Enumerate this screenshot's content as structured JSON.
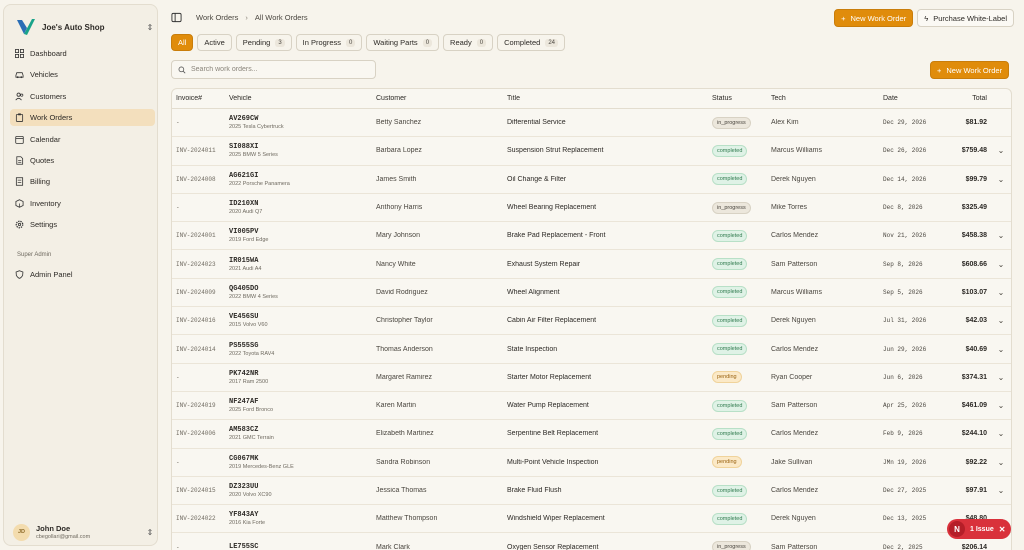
{
  "sidebar": {
    "shop_name": "Joe's Auto Shop",
    "items": [
      {
        "label": "Dashboard",
        "icon": "grid-icon"
      },
      {
        "label": "Vehicles",
        "icon": "car-icon"
      },
      {
        "label": "Customers",
        "icon": "users-icon"
      },
      {
        "label": "Work Orders",
        "icon": "clipboard-icon",
        "active": true
      },
      {
        "label": "Calendar",
        "icon": "calendar-icon"
      },
      {
        "label": "Quotes",
        "icon": "document-icon"
      },
      {
        "label": "Billing",
        "icon": "receipt-icon"
      },
      {
        "label": "Inventory",
        "icon": "box-icon"
      },
      {
        "label": "Settings",
        "icon": "gear-icon"
      }
    ],
    "section_label": "Super Admin",
    "admin_item": {
      "label": "Admin Panel",
      "icon": "shield-icon"
    },
    "user": {
      "initials": "JD",
      "name": "John Doe",
      "email": "cbegollari@gmail.com"
    }
  },
  "header": {
    "breadcrumb": [
      "Work Orders",
      "All Work Orders"
    ],
    "new_work_order": "New Work Order",
    "purchase_white_label": "Purchase White-Label"
  },
  "tabs": [
    {
      "label": "All",
      "count": null,
      "active": true
    },
    {
      "label": "Active",
      "count": null
    },
    {
      "label": "Pending",
      "count": "3"
    },
    {
      "label": "In Progress",
      "count": "0"
    },
    {
      "label": "Waiting Parts",
      "count": "0"
    },
    {
      "label": "Ready",
      "count": "0"
    },
    {
      "label": "Completed",
      "count": "24"
    }
  ],
  "search": {
    "placeholder": "Search work orders..."
  },
  "new_work_order_button": "New Work Order",
  "table": {
    "columns": [
      "Invoice#",
      "Vehicle",
      "Customer",
      "Title",
      "Status",
      "Tech",
      "Date",
      "Total"
    ],
    "rows": [
      {
        "invoice": "-",
        "plate": "AV269CW",
        "model": "2025 Tesla Cybertruck",
        "customer": "Betty Sanchez",
        "title": "Differential Service",
        "status": "in_progress",
        "tech": "Alex Kim",
        "date": "Dec 29, 2026",
        "total": "$81.92",
        "expand": false
      },
      {
        "invoice": "INV-2024011",
        "plate": "SI088XI",
        "model": "2025 BMW 5 Series",
        "customer": "Barbara Lopez",
        "title": "Suspension Strut Replacement",
        "status": "completed",
        "tech": "Marcus Williams",
        "date": "Dec 26, 2026",
        "total": "$759.48",
        "expand": true
      },
      {
        "invoice": "INV-2024008",
        "plate": "AG621GI",
        "model": "2022 Porsche Panamera",
        "customer": "James Smith",
        "title": "Oil Change & Filter",
        "status": "completed",
        "tech": "Derek Nguyen",
        "date": "Dec 14, 2026",
        "total": "$99.79",
        "expand": true
      },
      {
        "invoice": "-",
        "plate": "ID210XN",
        "model": "2020 Audi Q7",
        "customer": "Anthony Harris",
        "title": "Wheel Bearing Replacement",
        "status": "in_progress",
        "tech": "Mike Torres",
        "date": "Dec 8, 2026",
        "total": "$325.49",
        "expand": false
      },
      {
        "invoice": "INV-2024001",
        "plate": "VI005PV",
        "model": "2019 Ford Edge",
        "customer": "Mary Johnson",
        "title": "Brake Pad Replacement - Front",
        "status": "completed",
        "tech": "Carlos Mendez",
        "date": "Nov 21, 2026",
        "total": "$458.38",
        "expand": true
      },
      {
        "invoice": "INV-2024023",
        "plate": "IR015WA",
        "model": "2021 Audi A4",
        "customer": "Nancy White",
        "title": "Exhaust System Repair",
        "status": "completed",
        "tech": "Sam Patterson",
        "date": "Sep 8, 2026",
        "total": "$608.66",
        "expand": true
      },
      {
        "invoice": "INV-2024009",
        "plate": "QG405DO",
        "model": "2022 BMW 4 Series",
        "customer": "David Rodriguez",
        "title": "Wheel Alignment",
        "status": "completed",
        "tech": "Marcus Williams",
        "date": "Sep 5, 2026",
        "total": "$103.07",
        "expand": true
      },
      {
        "invoice": "INV-2024016",
        "plate": "VE456SU",
        "model": "2015 Volvo V60",
        "customer": "Christopher Taylor",
        "title": "Cabin Air Filter Replacement",
        "status": "completed",
        "tech": "Derek Nguyen",
        "date": "Jul 31, 2026",
        "total": "$42.03",
        "expand": true
      },
      {
        "invoice": "INV-2024014",
        "plate": "PS555SG",
        "model": "2022 Toyota RAV4",
        "customer": "Thomas Anderson",
        "title": "State Inspection",
        "status": "completed",
        "tech": "Carlos Mendez",
        "date": "Jun 29, 2026",
        "total": "$40.69",
        "expand": true
      },
      {
        "invoice": "-",
        "plate": "PK742NR",
        "model": "2017 Ram 2500",
        "customer": "Margaret Ramirez",
        "title": "Starter Motor Replacement",
        "status": "pending",
        "tech": "Ryan Cooper",
        "date": "Jun 6, 2026",
        "total": "$374.31",
        "expand": true
      },
      {
        "invoice": "INV-2024019",
        "plate": "NF247AF",
        "model": "2025 Ford Bronco",
        "customer": "Karen Martin",
        "title": "Water Pump Replacement",
        "status": "completed",
        "tech": "Sam Patterson",
        "date": "Apr 25, 2026",
        "total": "$461.09",
        "expand": true
      },
      {
        "invoice": "INV-2024006",
        "plate": "AM583CZ",
        "model": "2021 GMC Terrain",
        "customer": "Elizabeth Martinez",
        "title": "Serpentine Belt Replacement",
        "status": "completed",
        "tech": "Carlos Mendez",
        "date": "Feb 9, 2026",
        "total": "$244.10",
        "expand": true
      },
      {
        "invoice": "-",
        "plate": "CG067MK",
        "model": "2019 Mercedes-Benz GLE",
        "customer": "Sandra Robinson",
        "title": "Multi-Point Vehicle Inspection",
        "status": "pending",
        "tech": "Jake Sullivan",
        "date": "JMn 19, 2026",
        "total": "$92.22",
        "expand": true
      },
      {
        "invoice": "INV-2024015",
        "plate": "DZ323UU",
        "model": "2020 Volvo XC90",
        "customer": "Jessica Thomas",
        "title": "Brake Fluid Flush",
        "status": "completed",
        "tech": "Carlos Mendez",
        "date": "Dec 27, 2025",
        "total": "$97.91",
        "expand": true
      },
      {
        "invoice": "INV-2024022",
        "plate": "YF843AY",
        "model": "2016 Kia Forte",
        "customer": "Matthew Thompson",
        "title": "Windshield Wiper Replacement",
        "status": "completed",
        "tech": "Derek Nguyen",
        "date": "Dec 13, 2025",
        "total": "$48.80",
        "expand": true
      },
      {
        "invoice": "-",
        "plate": "LE755SC",
        "model": "",
        "customer": "Mark Clark",
        "title": "Oxygen Sensor Replacement",
        "status": "in_progress",
        "tech": "Sam Patterson",
        "date": "Dec 2, 2025",
        "total": "$206.14",
        "expand": false
      }
    ]
  },
  "issue_badge": {
    "letter": "N",
    "label": "1 Issue"
  }
}
